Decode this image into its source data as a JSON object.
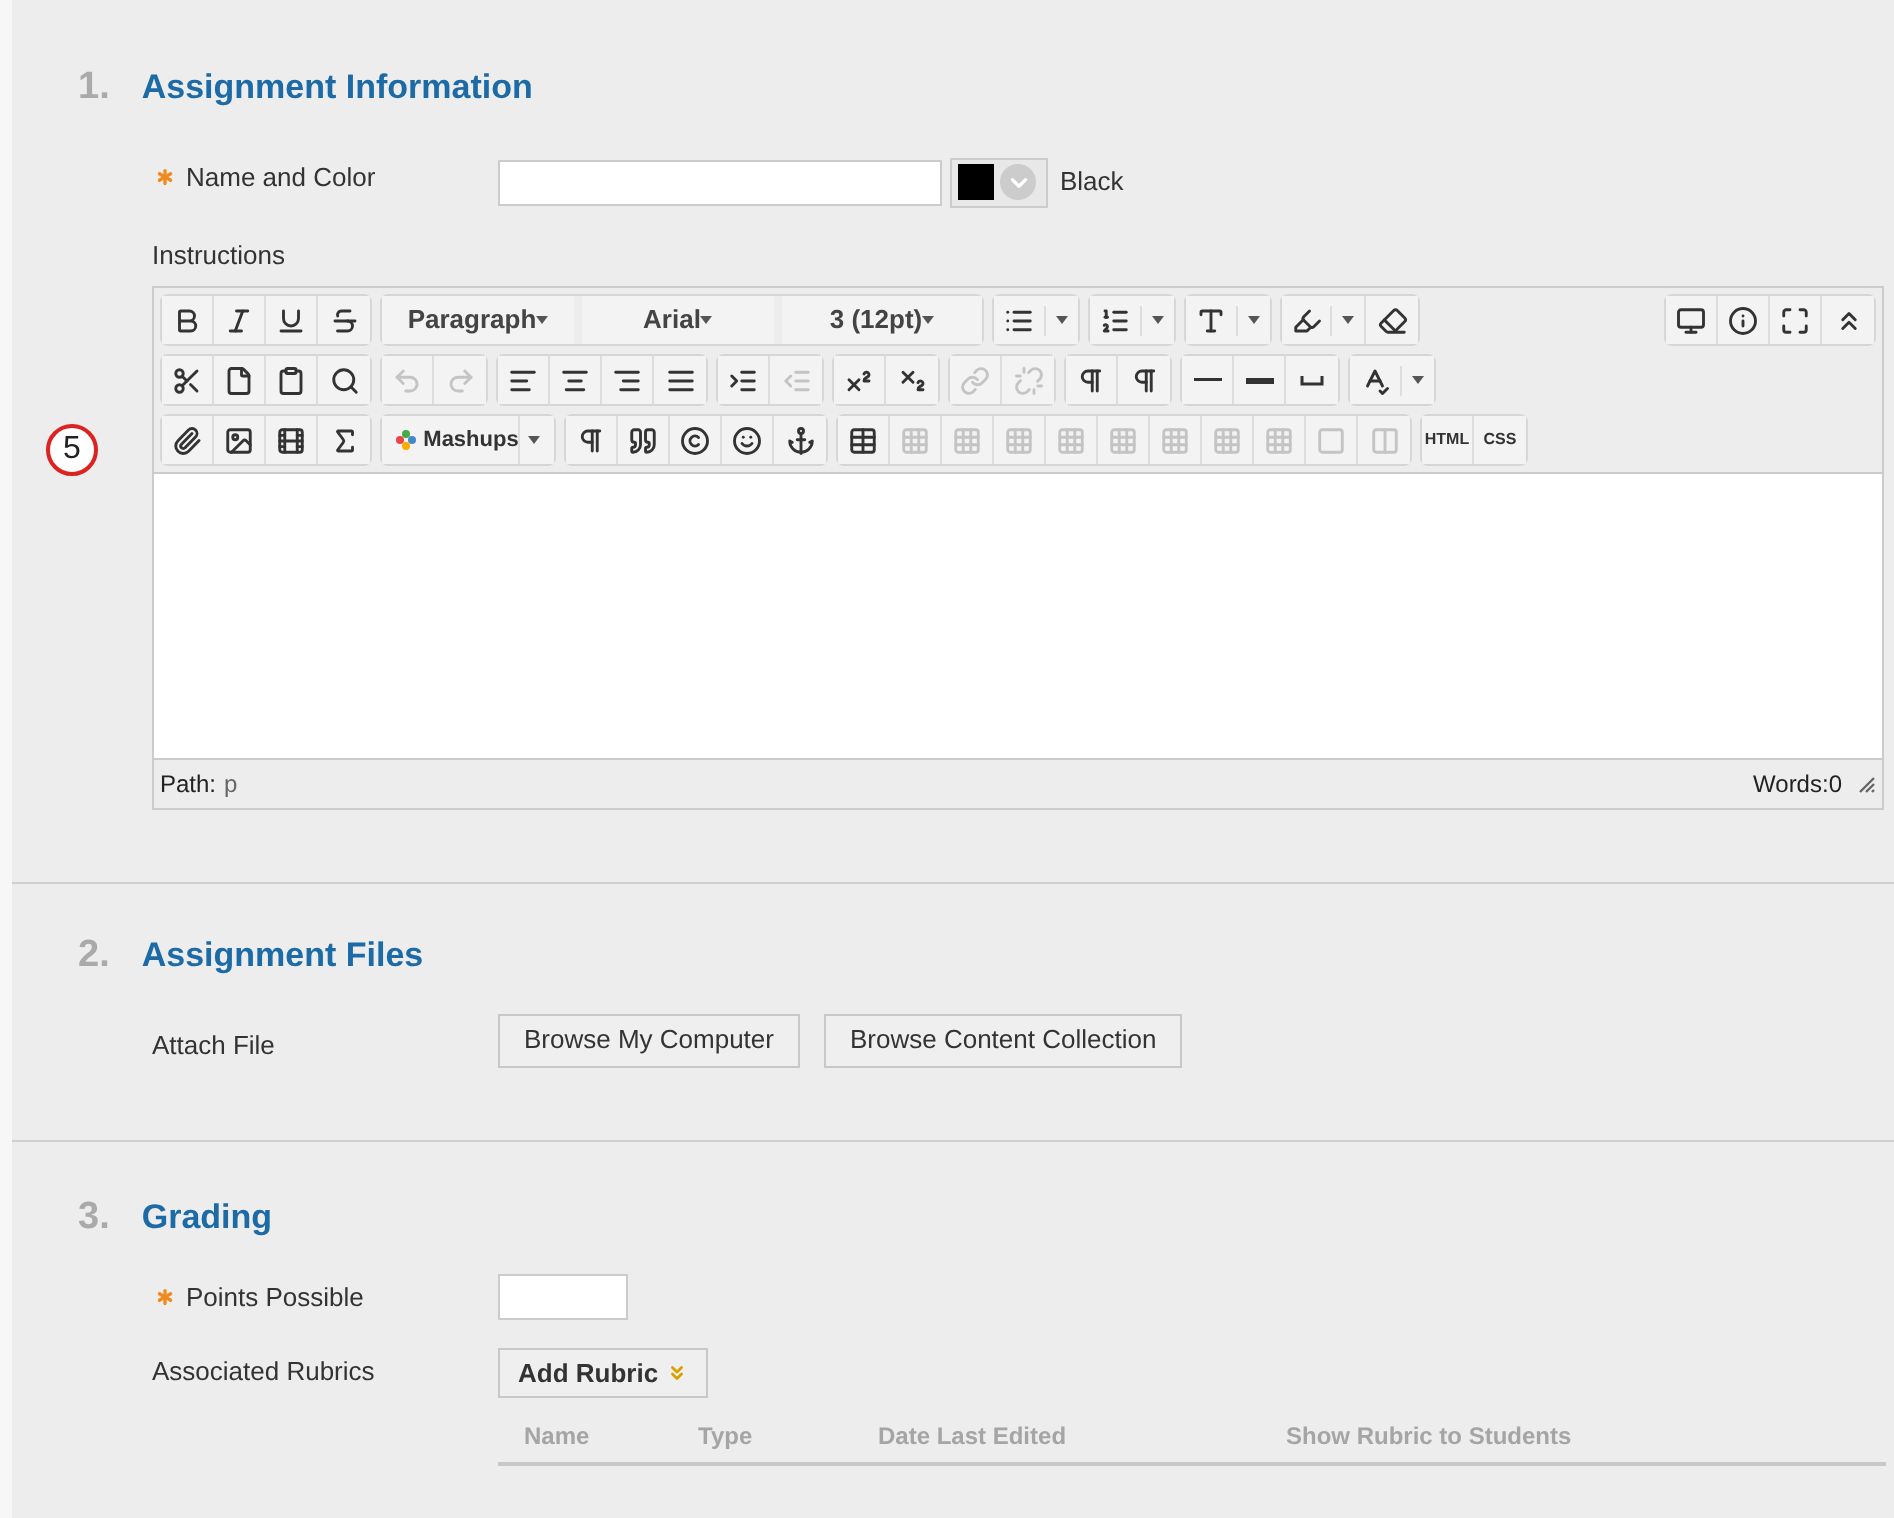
{
  "step_marker": "5",
  "sections": [
    {
      "number": "1.",
      "title": "Assignment Information",
      "kind": "info",
      "name_field": {
        "label": "Name and Color",
        "required": true,
        "color_name": "Black"
      },
      "instructions": {
        "label": "Instructions",
        "toolbar_rows": [
          [
            [
              {
                "kind": "icon",
                "disabled": false
              },
              {
                "kind": "icon",
                "disabled": false
              },
              {
                "kind": "icon",
                "disabled": false
              },
              {
                "kind": "icon",
                "disabled": false
              }
            ],
            [
              {
                "kind": "select",
                "label": "Paragraph"
              },
              {
                "kind": "select",
                "label": "Arial"
              },
              {
                "kind": "select",
                "label": "3 (12pt)"
              }
            ],
            [
              {
                "kind": "split",
                "disabled": false
              }
            ],
            [
              {
                "kind": "split",
                "disabled": false
              }
            ],
            [
              {
                "kind": "split",
                "disabled": false
              }
            ],
            [
              {
                "kind": "split",
                "disabled": false
              },
              {
                "kind": "icon",
                "disabled": false
              }
            ]
          ],
          [
            [
              {
                "kind": "icon",
                "disabled": false
              },
              {
                "kind": "icon",
                "disabled": false
              },
              {
                "kind": "icon",
                "disabled": false
              },
              {
                "kind": "icon",
                "disabled": false
              }
            ],
            [
              {
                "kind": "icon",
                "disabled": true
              },
              {
                "kind": "icon",
                "disabled": true
              }
            ],
            [
              {
                "kind": "icon",
                "disabled": false
              },
              {
                "kind": "icon",
                "disabled": false
              },
              {
                "kind": "icon",
                "disabled": false
              },
              {
                "kind": "icon",
                "disabled": false
              }
            ],
            [
              {
                "kind": "icon",
                "disabled": false
              },
              {
                "kind": "icon",
                "disabled": true
              }
            ],
            [
              {
                "kind": "icon",
                "disabled": false
              },
              {
                "kind": "icon",
                "disabled": false
              }
            ],
            [
              {
                "kind": "icon",
                "disabled": true
              },
              {
                "kind": "icon",
                "disabled": true
              }
            ],
            [
              {
                "kind": "icon",
                "disabled": false
              },
              {
                "kind": "icon",
                "disabled": false
              }
            ],
            [
              {
                "kind": "icon",
                "disabled": false
              },
              {
                "kind": "icon",
                "disabled": false
              },
              {
                "kind": "icon",
                "disabled": false
              }
            ],
            [
              {
                "kind": "split",
                "disabled": false
              }
            ]
          ],
          [
            [
              {
                "kind": "icon",
                "disabled": false
              },
              {
                "kind": "icon",
                "disabled": false
              },
              {
                "kind": "icon",
                "disabled": false
              },
              {
                "kind": "icon",
                "disabled": false
              }
            ],
            [
              {
                "kind": "mashups",
                "label": "Mashups"
              }
            ],
            [
              {
                "kind": "icon",
                "disabled": false
              },
              {
                "kind": "icon",
                "disabled": false
              },
              {
                "kind": "icon",
                "disabled": false
              },
              {
                "kind": "icon",
                "disabled": false
              },
              {
                "kind": "icon",
                "disabled": false
              }
            ],
            [
              {
                "kind": "icon",
                "disabled": false
              },
              {
                "kind": "icon",
                "disabled": true
              },
              {
                "kind": "icon",
                "disabled": true
              },
              {
                "kind": "icon",
                "disabled": true
              },
              {
                "kind": "icon",
                "disabled": true
              },
              {
                "kind": "icon",
                "disabled": true
              },
              {
                "kind": "icon",
                "disabled": true
              },
              {
                "kind": "icon",
                "disabled": true
              },
              {
                "kind": "icon",
                "disabled": true
              },
              {
                "kind": "icon",
                "disabled": true
              },
              {
                "kind": "icon",
                "disabled": true
              }
            ],
            [
              {
                "kind": "text",
                "label": "HTML"
              },
              {
                "kind": "text",
                "label": "CSS"
              }
            ]
          ]
        ],
        "right_tools": [
          {
            "kind": "icon",
            "disabled": false
          },
          {
            "kind": "icon",
            "disabled": false
          },
          {
            "kind": "icon",
            "disabled": false
          },
          {
            "kind": "icon",
            "disabled": false
          }
        ],
        "path_label": "Path:",
        "path_value": "p",
        "word_count": "Words:0"
      }
    },
    {
      "number": "2.",
      "title": "Assignment Files",
      "kind": "files",
      "attach_label": "Attach File",
      "buttons": [
        "Browse My Computer",
        "Browse Content Collection"
      ]
    },
    {
      "number": "3.",
      "title": "Grading",
      "kind": "grading",
      "points": {
        "label": "Points Possible",
        "required": true
      },
      "rubrics": {
        "label": "Associated Rubrics",
        "button": "Add Rubric",
        "columns": [
          "Name",
          "Type",
          "Date Last Edited",
          "Show Rubric to Students"
        ]
      }
    }
  ]
}
